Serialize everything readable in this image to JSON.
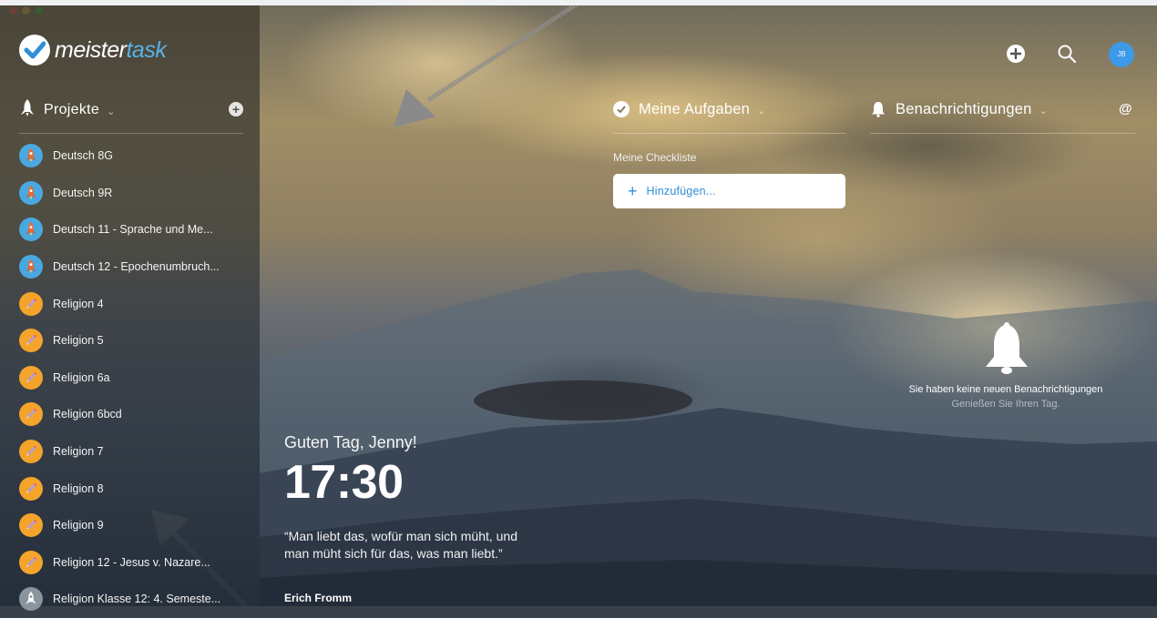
{
  "window": {
    "controls": [
      "close",
      "minimize",
      "zoom"
    ],
    "colors": {
      "close": "#fc5753",
      "minimize": "#fdbc40",
      "zoom": "#33c748"
    }
  },
  "app": {
    "logo_part1": "meister",
    "logo_part2": "task",
    "brand_color": "#58b2ea"
  },
  "sidebar": {
    "projects_title": "Projekte",
    "projects": [
      {
        "label": "Deutsch 8G",
        "icon": "rocket-icon",
        "color": "blue"
      },
      {
        "label": "Deutsch 9R",
        "icon": "rocket-icon",
        "color": "blue"
      },
      {
        "label": "Deutsch 11 - Sprache und Me...",
        "icon": "rocket-icon",
        "color": "blue"
      },
      {
        "label": "Deutsch 12 - Epochenumbruch...",
        "icon": "rocket-icon",
        "color": "blue"
      },
      {
        "label": "Religion 4",
        "icon": "pencil-icon",
        "color": "orange"
      },
      {
        "label": "Religion 5",
        "icon": "pencil-icon",
        "color": "orange"
      },
      {
        "label": "Religion 6a",
        "icon": "pencil-icon",
        "color": "orange"
      },
      {
        "label": "Religion 6bcd",
        "icon": "pencil-icon",
        "color": "orange"
      },
      {
        "label": "Religion 7",
        "icon": "pencil-icon",
        "color": "orange"
      },
      {
        "label": "Religion 8",
        "icon": "pencil-icon",
        "color": "orange"
      },
      {
        "label": "Religion 9",
        "icon": "pencil-icon",
        "color": "orange"
      },
      {
        "label": "Religion 12 - Jesus v. Nazare...",
        "icon": "pencil-icon",
        "color": "orange"
      },
      {
        "label": "Religion Klasse 12: 4. Semeste...",
        "icon": "rocket-icon",
        "color": "gray"
      }
    ]
  },
  "header": {
    "avatar_initials": "JB",
    "icons": [
      "add-icon",
      "search-icon"
    ]
  },
  "tasks": {
    "title": "Meine Aufgaben",
    "checklist_label": "Meine Checkliste",
    "add_label": "Hinzufügen..."
  },
  "notifications": {
    "title": "Benachrichtigungen",
    "mention_symbol": "@",
    "empty_title": "Sie haben keine neuen Benachrichtigungen",
    "empty_subtitle": "Genießen Sie Ihren Tag."
  },
  "dashboard": {
    "greeting": "Guten Tag, Jenny!",
    "time": "17:30",
    "quote": "“Man liebt das, wofür man sich müht, und man müht sich für das, was man liebt.”",
    "author": "Erich Fromm"
  }
}
